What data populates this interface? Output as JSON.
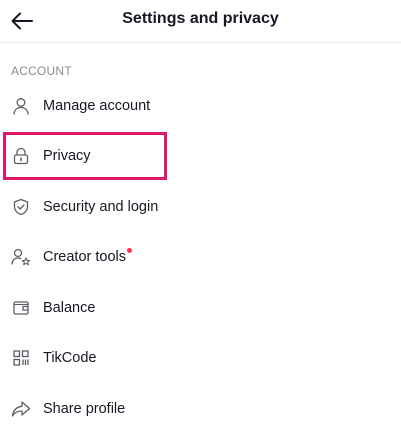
{
  "header": {
    "title": "Settings and privacy",
    "back_icon": "arrow-left-icon"
  },
  "section": {
    "label": "ACCOUNT"
  },
  "items": [
    {
      "label": "Manage account",
      "icon": "person-icon"
    },
    {
      "label": "Privacy",
      "icon": "lock-icon"
    },
    {
      "label": "Security and login",
      "icon": "shield-check-icon"
    },
    {
      "label": "Creator tools",
      "icon": "creator-star-icon",
      "badge": "red-dot"
    },
    {
      "label": "Balance",
      "icon": "wallet-icon"
    },
    {
      "label": "TikCode",
      "icon": "qr-code-icon"
    },
    {
      "label": "Share profile",
      "icon": "share-arrow-icon"
    }
  ],
  "colors": {
    "text": "#161823",
    "muted": "#8a8b91",
    "highlight": "#e0166d",
    "badge": "#fe2c55"
  }
}
